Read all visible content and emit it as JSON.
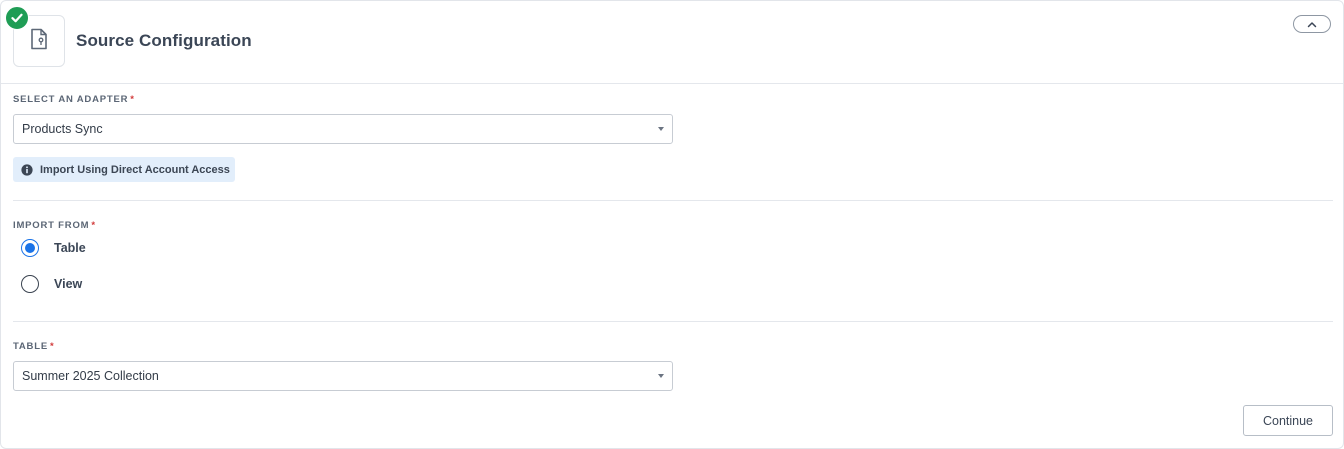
{
  "header": {
    "title": "Source Configuration",
    "status_icon": "check-circle-icon",
    "source_icon": "file-icon",
    "collapse_icon": "chevron-up-icon"
  },
  "adapter": {
    "label": "SELECT AN ADAPTER",
    "required_mark": "*",
    "value": "Products Sync",
    "info_badge": "Import Using Direct Account Access"
  },
  "import_from": {
    "label": "IMPORT FROM",
    "required_mark": "*",
    "options": [
      {
        "label": "Table",
        "selected": true
      },
      {
        "label": "View",
        "selected": false
      }
    ]
  },
  "table": {
    "label": "TABLE",
    "required_mark": "*",
    "value": "Summer 2025 Collection"
  },
  "footer": {
    "continue_label": "Continue"
  },
  "colors": {
    "accent": "#1a73e8",
    "success": "#1f9d55",
    "required": "#d23b3b",
    "info_bg": "#e2eefb"
  }
}
